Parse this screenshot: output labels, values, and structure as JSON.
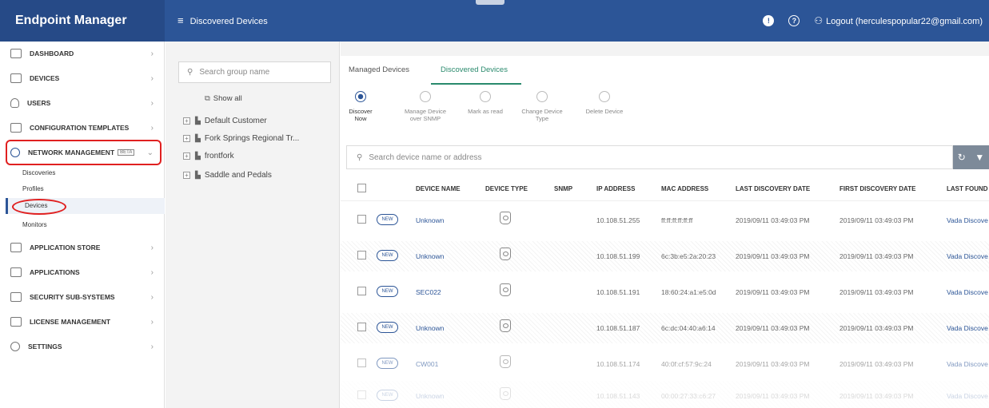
{
  "app": {
    "brand": "Endpoint Manager",
    "page_title": "Discovered Devices"
  },
  "header": {
    "notification_icon": "notification-icon",
    "help_icon": "help-icon",
    "logout": "Logout (herculespopular22@gmail.com)"
  },
  "sidebar": {
    "items": [
      {
        "label": "DASHBOARD",
        "icon": "dashboard-icon"
      },
      {
        "label": "DEVICES",
        "icon": "devices-icon"
      },
      {
        "label": "USERS",
        "icon": "users-icon"
      },
      {
        "label": "CONFIGURATION TEMPLATES",
        "icon": "templates-icon"
      },
      {
        "label": "NETWORK MANAGEMENT",
        "icon": "network-icon",
        "badge": "BETA",
        "expanded": true
      },
      {
        "label": "APPLICATION STORE",
        "icon": "store-icon"
      },
      {
        "label": "APPLICATIONS",
        "icon": "applications-icon"
      },
      {
        "label": "SECURITY SUB-SYSTEMS",
        "icon": "security-icon"
      },
      {
        "label": "LICENSE MANAGEMENT",
        "icon": "license-icon"
      },
      {
        "label": "SETTINGS",
        "icon": "settings-icon"
      }
    ],
    "sub_items": [
      {
        "label": "Discoveries"
      },
      {
        "label": "Profiles"
      },
      {
        "label": "Devices",
        "active": true
      },
      {
        "label": "Monitors"
      }
    ]
  },
  "groups": {
    "search_placeholder": "Search group name",
    "show_all": "Show all",
    "list": [
      "Default Customer",
      "Fork Springs Regional Tr...",
      "frontfork",
      "Saddle and Pedals"
    ]
  },
  "tabs": [
    {
      "label": "Managed Devices",
      "active": false
    },
    {
      "label": "Discovered Devices",
      "active": true
    }
  ],
  "toolbar": {
    "discover_now": "Discover Now",
    "manage_snmp_1": "Manage Device",
    "manage_snmp_2": "over SNMP",
    "mark_read": "Mark as read",
    "change_type_1": "Change Device",
    "change_type_2": "Type",
    "delete": "Delete Device"
  },
  "device_search": {
    "placeholder": "Search device name or address"
  },
  "table": {
    "columns": [
      "DEVICE NAME",
      "DEVICE TYPE",
      "SNMP",
      "IP ADDRESS",
      "MAC ADDRESS",
      "LAST DISCOVERY DATE",
      "FIRST DISCOVERY DATE",
      "LAST FOUND"
    ],
    "rows": [
      {
        "badge": "NEW",
        "name": "Unknown",
        "ip": "10.108.51.255",
        "mac": "ff:ff:ff:ff:ff:ff",
        "last": "2019/09/11 03:49:03 PM",
        "first": "2019/09/11 03:49:03 PM",
        "found": "Vada Discove"
      },
      {
        "badge": "NEW",
        "name": "Unknown",
        "ip": "10.108.51.199",
        "mac": "6c:3b:e5:2a:20:23",
        "last": "2019/09/11 03:49:03 PM",
        "first": "2019/09/11 03:49:03 PM",
        "found": "Vada Discove"
      },
      {
        "badge": "NEW",
        "name": "SEC022",
        "ip": "10.108.51.191",
        "mac": "18:60:24:a1:e5:0d",
        "last": "2019/09/11 03:49:03 PM",
        "first": "2019/09/11 03:49:03 PM",
        "found": "Vada Discove"
      },
      {
        "badge": "NEW",
        "name": "Unknown",
        "ip": "10.108.51.187",
        "mac": "6c:dc:04:40:a6:14",
        "last": "2019/09/11 03:49:03 PM",
        "first": "2019/09/11 03:49:03 PM",
        "found": "Vada Discove"
      },
      {
        "badge": "NEW",
        "name": "CW001",
        "ip": "10.108.51.174",
        "mac": "40:0f:cf:57:9c:24",
        "last": "2019/09/11 03:49:03 PM",
        "first": "2019/09/11 03:49:03 PM",
        "found": "Vada Discove"
      },
      {
        "badge": "NEW",
        "name": "Unknown",
        "ip": "10.108.51.143",
        "mac": "00:00:27:33:c6:27",
        "last": "2019/09/11 03:49:03 PM",
        "first": "2019/09/11 03:49:03 PM",
        "found": "Vada Discove"
      }
    ]
  },
  "colors": {
    "brand_blue": "#2c5597",
    "accent_green": "#2a8a6d",
    "highlight_red": "#e02020"
  }
}
